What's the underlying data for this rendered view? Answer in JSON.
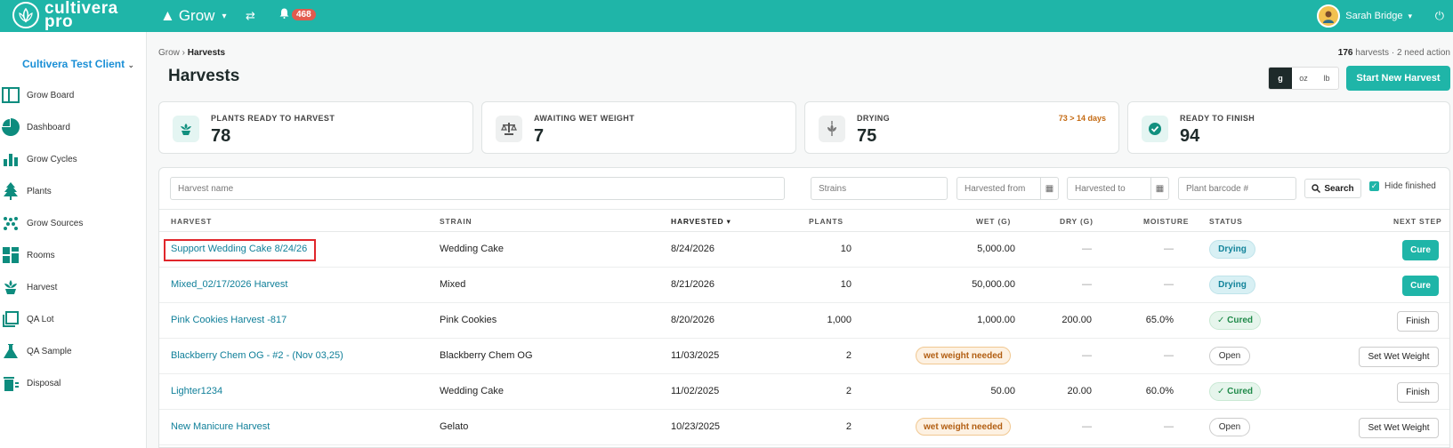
{
  "topbar": {
    "logo_line1": "cultivera",
    "logo_line2": "pro",
    "module": "Grow",
    "notification_count": "468",
    "user_name": "Sarah Bridge"
  },
  "sidebar": {
    "client": "Cultivera Test Client",
    "items": [
      {
        "label": "Grow Board",
        "icon": "grow-board-icon"
      },
      {
        "label": "Dashboard",
        "icon": "pie-chart-icon"
      },
      {
        "label": "Grow Cycles",
        "icon": "bar-chart-icon"
      },
      {
        "label": "Plants",
        "icon": "tree-icon"
      },
      {
        "label": "Grow Sources",
        "icon": "seeds-icon"
      },
      {
        "label": "Rooms",
        "icon": "rooms-icon"
      },
      {
        "label": "Harvest",
        "icon": "harvest-icon"
      },
      {
        "label": "QA Lot",
        "icon": "qa-lot-icon"
      },
      {
        "label": "QA Sample",
        "icon": "flask-icon"
      },
      {
        "label": "Disposal",
        "icon": "trash-icon"
      }
    ]
  },
  "header": {
    "breadcrumb_parent": "Grow",
    "breadcrumb_current": "Harvests",
    "summary_count": "176",
    "summary_text": "harvests · 2 need action",
    "title": "Harvests",
    "units": [
      "g",
      "oz",
      "lb"
    ],
    "active_unit": "g",
    "start_button": "Start New Harvest"
  },
  "cards": [
    {
      "label": "PLANTS READY TO HARVEST",
      "value": "78",
      "note": "",
      "icon": "sprout-icon",
      "color": "#e4f5f2"
    },
    {
      "label": "AWAITING WET WEIGHT",
      "value": "7",
      "note": "",
      "icon": "scale-icon",
      "color": "#eef0f0"
    },
    {
      "label": "DRYING",
      "value": "75",
      "note": "73 > 14 days",
      "icon": "hanging-plant-icon",
      "color": "#eef0f0"
    },
    {
      "label": "READY TO FINISH",
      "value": "94",
      "note": "",
      "icon": "check-circle-icon",
      "color": "#e4f5f2"
    }
  ],
  "filters": {
    "harvest_name": "Harvest name",
    "strains": "Strains",
    "harvested_from": "Harvested from",
    "harvested_to": "Harvested to",
    "plant_barcode": "Plant barcode #",
    "search": "Search",
    "hide_finished": "Hide finished"
  },
  "table": {
    "headers": {
      "harvest": "HARVEST",
      "strain": "STRAIN",
      "harvested": "HARVESTED",
      "plants": "PLANTS",
      "wet": "WET (G)",
      "dry": "DRY (G)",
      "moisture": "MOISTURE",
      "status": "STATUS",
      "next_step": "NEXT STEP"
    },
    "rows": [
      {
        "harvest": "Support Wedding Cake 8/24/26",
        "strain": "Wedding Cake",
        "harvested": "8/24/2026",
        "plants": "10",
        "wet": "5,000.00",
        "dry": "—",
        "moisture": "—",
        "status": "Drying",
        "next": "Cure"
      },
      {
        "harvest": "Mixed_02/17/2026 Harvest",
        "strain": "Mixed",
        "harvested": "8/21/2026",
        "plants": "10",
        "wet": "50,000.00",
        "dry": "—",
        "moisture": "—",
        "status": "Drying",
        "next": "Cure"
      },
      {
        "harvest": "Pink Cookies Harvest -817",
        "strain": "Pink Cookies",
        "harvested": "8/20/2026",
        "plants": "1,000",
        "wet": "1,000.00",
        "dry": "200.00",
        "moisture": "65.0%",
        "status": "✓ Cured",
        "next": "Finish"
      },
      {
        "harvest": "Blackberry Chem OG - #2 - (Nov 03,25)",
        "strain": "Blackberry Chem OG",
        "harvested": "11/03/2025",
        "plants": "2",
        "wet": "wet weight needed",
        "dry": "—",
        "moisture": "—",
        "status": "Open",
        "next": "Set Wet Weight"
      },
      {
        "harvest": "Lighter1234",
        "strain": "Wedding Cake",
        "harvested": "11/02/2025",
        "plants": "2",
        "wet": "50.00",
        "dry": "20.00",
        "moisture": "60.0%",
        "status": "✓ Cured",
        "next": "Finish"
      },
      {
        "harvest": "New Manicure Harvest",
        "strain": "Gelato",
        "harvested": "10/23/2025",
        "plants": "2",
        "wet": "wet weight needed",
        "dry": "—",
        "moisture": "—",
        "status": "Open",
        "next": "Set Wet Weight"
      }
    ]
  },
  "colors": {
    "accent": "#1fb5a8",
    "link": "#0f7f99",
    "highlight": "#e0262b"
  }
}
